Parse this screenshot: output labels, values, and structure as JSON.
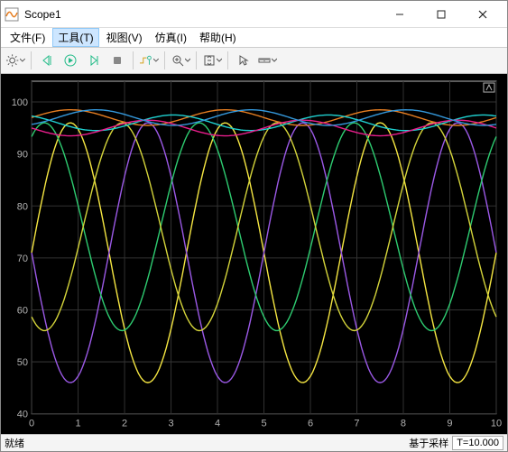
{
  "window": {
    "title": "Scope1"
  },
  "menus": {
    "file": "文件(F)",
    "tools": "工具(T)",
    "view": "视图(V)",
    "simulation": "仿真(I)",
    "help": "帮助(H)"
  },
  "status": {
    "left": "就绪",
    "sample": "基于采样",
    "time": "T=10.000"
  },
  "chart_data": {
    "type": "line",
    "xlim": [
      0,
      10
    ],
    "ylim": [
      40,
      104
    ],
    "xticks": [
      0,
      1,
      2,
      3,
      4,
      5,
      6,
      7,
      8,
      9,
      10
    ],
    "yticks": [
      40,
      50,
      60,
      70,
      80,
      90,
      100
    ],
    "xlabel": "",
    "ylabel": "",
    "title": "",
    "series": [
      {
        "name": "s1_yellow",
        "color": "#f5e642",
        "phase_norm": 0.0,
        "amp": 25,
        "offset": 71
      },
      {
        "name": "s2_purple",
        "color": "#9b59e6",
        "phase_norm": 0.5,
        "amp": 25,
        "offset": 71
      },
      {
        "name": "s3_green",
        "color": "#2ecc71",
        "phase_norm": 0.167,
        "amp": 20,
        "offset": 76
      },
      {
        "name": "s4_yellow2",
        "color": "#d4d43a",
        "phase_norm": 0.667,
        "amp": 20,
        "offset": 76
      },
      {
        "name": "s5_orange",
        "color": "#e67e22",
        "phase_norm": 0.0,
        "amp": 1.5,
        "offset": 97
      },
      {
        "name": "s6_cyan",
        "color": "#1fd1d1",
        "phase_norm": 0.333,
        "amp": 1.5,
        "offset": 96
      },
      {
        "name": "s7_magenta",
        "color": "#e91e8c",
        "phase_norm": 0.5,
        "amp": 1.5,
        "offset": 95
      },
      {
        "name": "s8_blue",
        "color": "#3498db",
        "phase_norm": 0.833,
        "amp": 1.5,
        "offset": 97
      }
    ]
  },
  "colors": {
    "plot_bg": "#000000",
    "grid": "#323232",
    "axis_text": "#b2b2b2"
  }
}
